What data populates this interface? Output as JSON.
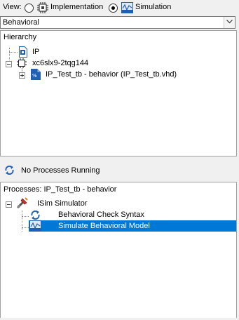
{
  "view": {
    "label": "View:",
    "options": [
      {
        "label": "Implementation",
        "selected": false,
        "icon": "implementation-chip-icon"
      },
      {
        "label": "Simulation",
        "selected": true,
        "icon": "isim-icon"
      }
    ]
  },
  "combo": {
    "value": "Behavioral"
  },
  "hierarchy": {
    "title": "Hierarchy",
    "items": [
      {
        "label": "IP",
        "icon": "ip-document-icon"
      },
      {
        "label": "xc6slx9-2tqg144",
        "icon": "fpga-chip-icon"
      },
      {
        "label": "IP_Test_tb - behavior (IP_Test_tb.vhd)",
        "icon": "vhdl-file-icon"
      }
    ]
  },
  "status": {
    "text": "No Processes Running",
    "icon": "refresh-icon"
  },
  "processes": {
    "title": "Processes: IP_Test_tb - behavior",
    "items": [
      {
        "label": "ISim Simulator",
        "icon": "tools-icon"
      },
      {
        "label": "Behavioral Check Syntax",
        "icon": "refresh-icon"
      },
      {
        "label": "Simulate Behavioral Model",
        "icon": "isim-icon",
        "selected": true
      }
    ]
  },
  "colors": {
    "selection": "#0078d7",
    "isim_blue": "#1f5fb5"
  }
}
